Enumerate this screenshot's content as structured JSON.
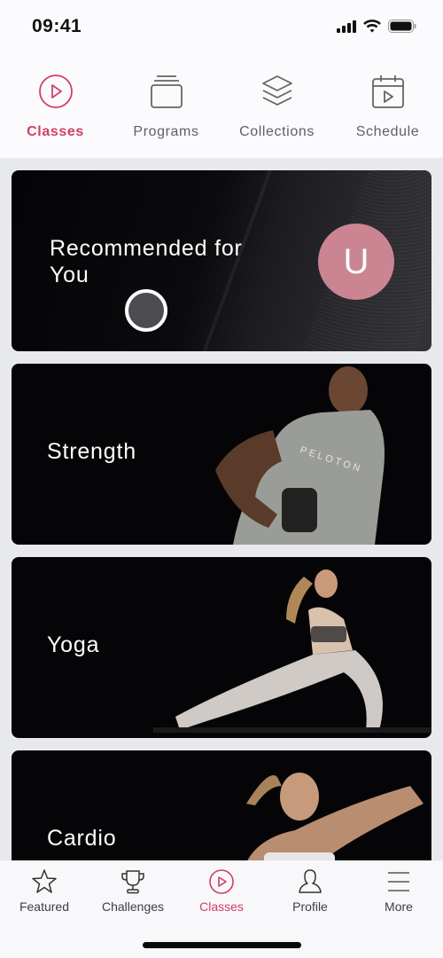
{
  "status_bar": {
    "time": "09:41"
  },
  "top_nav": {
    "tabs": [
      {
        "label": "Classes",
        "icon": "play-circle-icon",
        "active": true
      },
      {
        "label": "Programs",
        "icon": "stack-card-icon",
        "active": false
      },
      {
        "label": "Collections",
        "icon": "layers-icon",
        "active": false
      },
      {
        "label": "Schedule",
        "icon": "calendar-play-icon",
        "active": false
      }
    ]
  },
  "cards": [
    {
      "title": "Recommended for You",
      "avatar_initial": "U"
    },
    {
      "title": "Strength",
      "image": "instructor-strength-image"
    },
    {
      "title": "Yoga",
      "image": "instructor-yoga-image"
    },
    {
      "title": "Cardio",
      "image": "instructor-cardio-image"
    }
  ],
  "bottom_nav": {
    "tabs": [
      {
        "label": "Featured",
        "icon": "star-icon",
        "active": false
      },
      {
        "label": "Challenges",
        "icon": "trophy-icon",
        "active": false
      },
      {
        "label": "Classes",
        "icon": "play-circle-icon",
        "active": true
      },
      {
        "label": "Profile",
        "icon": "person-icon",
        "active": false
      },
      {
        "label": "More",
        "icon": "menu-icon",
        "active": false
      }
    ]
  },
  "colors": {
    "accent": "#d13f66",
    "avatar": "#cb8592",
    "text_muted": "#5f6067"
  }
}
